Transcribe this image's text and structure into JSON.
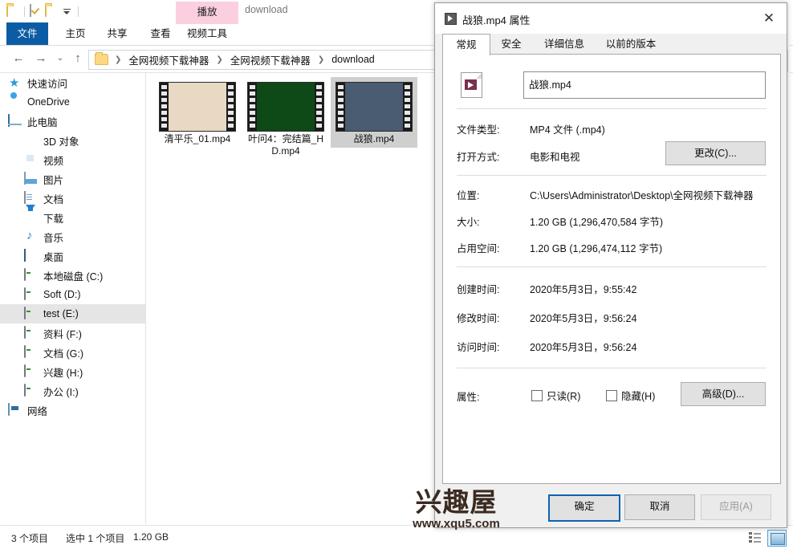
{
  "explorer": {
    "quick_access": {
      "items": [
        {
          "name": "folder-icon",
          "label": ""
        },
        {
          "name": "properties-checkbox-icon",
          "label": ""
        },
        {
          "name": "new-folder-icon",
          "label": ""
        },
        {
          "name": "customize-dropdown-icon",
          "label": ""
        }
      ]
    },
    "window_title": "download",
    "contextual_tab": "播放",
    "ribbon_tabs": [
      {
        "label": "文件",
        "active": true
      },
      {
        "label": "主页",
        "active": false
      },
      {
        "label": "共享",
        "active": false
      },
      {
        "label": "查看",
        "active": false
      },
      {
        "label": "视频工具",
        "active": false
      }
    ],
    "nav": {
      "back": "←",
      "forward": "→",
      "recent": "⌄",
      "up": "↑"
    },
    "breadcrumb": [
      "全网视频下载神器",
      "全网视频下载神器",
      "download"
    ],
    "sidebar": [
      {
        "label": "快速访问",
        "icon": "star-icon",
        "level": 1,
        "selected": false
      },
      {
        "label": "OneDrive",
        "icon": "cloud-icon",
        "level": 1,
        "selected": false
      },
      {
        "label": "此电脑",
        "icon": "this-pc-icon",
        "level": 1,
        "selected": false
      },
      {
        "label": "3D 对象",
        "icon": "3d-objects-icon",
        "level": 2,
        "selected": false
      },
      {
        "label": "视频",
        "icon": "videos-icon",
        "level": 2,
        "selected": false
      },
      {
        "label": "图片",
        "icon": "pictures-icon",
        "level": 2,
        "selected": false
      },
      {
        "label": "文档",
        "icon": "documents-icon",
        "level": 2,
        "selected": false
      },
      {
        "label": "下载",
        "icon": "downloads-icon",
        "level": 2,
        "selected": false
      },
      {
        "label": "音乐",
        "icon": "music-icon",
        "level": 2,
        "selected": false
      },
      {
        "label": "桌面",
        "icon": "desktop-icon",
        "level": 2,
        "selected": false
      },
      {
        "label": "本地磁盘 (C:)",
        "icon": "drive-icon",
        "level": 2,
        "selected": false
      },
      {
        "label": "Soft (D:)",
        "icon": "drive-icon",
        "level": 2,
        "selected": false
      },
      {
        "label": "test (E:)",
        "icon": "drive-icon",
        "level": 2,
        "selected": true
      },
      {
        "label": "资料 (F:)",
        "icon": "drive-icon",
        "level": 2,
        "selected": false
      },
      {
        "label": "文档 (G:)",
        "icon": "drive-icon",
        "level": 2,
        "selected": false
      },
      {
        "label": "兴趣 (H:)",
        "icon": "drive-icon",
        "level": 2,
        "selected": false
      },
      {
        "label": "办公 (I:)",
        "icon": "drive-icon",
        "level": 2,
        "selected": false
      },
      {
        "label": "网络",
        "icon": "network-icon",
        "level": 1,
        "selected": false
      }
    ],
    "files": [
      {
        "name": "清平乐_01.mp4",
        "selected": false,
        "thumb": "#e8d8c4"
      },
      {
        "name": "叶问4：完结篇_HD.mp4",
        "selected": false,
        "thumb": "#0d4a18"
      },
      {
        "name": "战狼.mp4",
        "selected": true,
        "thumb": "#4a5c72"
      }
    ],
    "status": {
      "item_count": "3 个项目",
      "selection": "选中 1 个项目",
      "size": "1.20 GB"
    },
    "view_buttons": [
      {
        "name": "details-view-button",
        "active": false
      },
      {
        "name": "large-icons-view-button",
        "active": true
      }
    ],
    "help_icon": "?"
  },
  "dialog": {
    "title": "战狼.mp4 属性",
    "close_label": "✕",
    "tabs": [
      {
        "label": "常规",
        "active": true
      },
      {
        "label": "安全",
        "active": false
      },
      {
        "label": "详细信息",
        "active": false
      },
      {
        "label": "以前的版本",
        "active": false
      }
    ],
    "filename_value": "战狼.mp4",
    "fields": [
      {
        "label": "文件类型:",
        "value": "MP4 文件 (.mp4)"
      },
      {
        "label": "打开方式:",
        "value": "电影和电视"
      },
      {
        "label": "位置:",
        "value": "C:\\Users\\Administrator\\Desktop\\全网视频下载神器"
      },
      {
        "label": "大小:",
        "value": "1.20 GB (1,296,470,584 字节)"
      },
      {
        "label": "占用空间:",
        "value": "1.20 GB (1,296,474,112 字节)"
      },
      {
        "label": "创建时间:",
        "value": "2020年5月3日，9:55:42"
      },
      {
        "label": "修改时间:",
        "value": "2020年5月3日，9:56:24"
      },
      {
        "label": "访问时间:",
        "value": "2020年5月3日，9:56:24"
      }
    ],
    "change_button": "更改(C)...",
    "attributes_label": "属性:",
    "readonly_checkbox": "只读(R)",
    "hidden_checkbox": "隐藏(H)",
    "advanced_button": "高级(D)...",
    "ok_button": "确定",
    "cancel_button": "取消",
    "apply_button": "应用(A)"
  },
  "watermark": {
    "main": "兴趣屋",
    "sub": "www.xqu5.com"
  },
  "colors": {
    "accent": "#0c5ca5",
    "contextual_tab": "#fbcfe0",
    "selection": "#cfcfcf",
    "default_button_border": "#0c63b0"
  }
}
